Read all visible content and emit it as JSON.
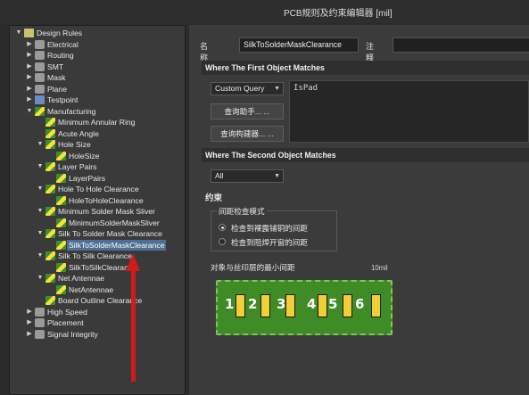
{
  "window": {
    "title": "PCB规则及约束编辑器 [mil]"
  },
  "tree": {
    "items": [
      {
        "label": "Design Rules",
        "level": 0,
        "expander": "▼",
        "icon": "folder"
      },
      {
        "label": "Electrical",
        "level": 1,
        "expander": "▶",
        "icon": "gray"
      },
      {
        "label": "Routing",
        "level": 1,
        "expander": "▶",
        "icon": "gray"
      },
      {
        "label": "SMT",
        "level": 1,
        "expander": "▶",
        "icon": "gray"
      },
      {
        "label": "Mask",
        "level": 1,
        "expander": "▶",
        "icon": "gray"
      },
      {
        "label": "Plane",
        "level": 1,
        "expander": "▶",
        "icon": "gray"
      },
      {
        "label": "Testpoint",
        "level": 1,
        "expander": "▶",
        "icon": "blue"
      },
      {
        "label": "Manufacturing",
        "level": 1,
        "expander": "▼",
        "icon": "rule"
      },
      {
        "label": "Minimum Annular Ring",
        "level": 2,
        "expander": "",
        "icon": "rule"
      },
      {
        "label": "Acute Angle",
        "level": 2,
        "expander": "",
        "icon": "rule"
      },
      {
        "label": "Hole Size",
        "level": 2,
        "expander": "▼",
        "icon": "rule"
      },
      {
        "label": "HoleSize",
        "level": 3,
        "expander": "",
        "icon": "rule"
      },
      {
        "label": "Layer Pairs",
        "level": 2,
        "expander": "▼",
        "icon": "rule"
      },
      {
        "label": "LayerPairs",
        "level": 3,
        "expander": "",
        "icon": "rule"
      },
      {
        "label": "Hole To Hole Clearance",
        "level": 2,
        "expander": "▼",
        "icon": "rule"
      },
      {
        "label": "HoleToHoleClearance",
        "level": 3,
        "expander": "",
        "icon": "rule"
      },
      {
        "label": "Minimum Solder Mask Sliver",
        "level": 2,
        "expander": "▼",
        "icon": "rule"
      },
      {
        "label": "MinimumSolderMaskSliver",
        "level": 3,
        "expander": "",
        "icon": "rule"
      },
      {
        "label": "Silk To Solder Mask Clearance",
        "level": 2,
        "expander": "▼",
        "icon": "rule"
      },
      {
        "label": "SilkToSolderMaskClearance",
        "level": 3,
        "expander": "",
        "icon": "rule",
        "selected": true
      },
      {
        "label": "Silk To Silk Clearance",
        "level": 2,
        "expander": "▼",
        "icon": "rule"
      },
      {
        "label": "SilkToSilkClearance",
        "level": 3,
        "expander": "",
        "icon": "rule"
      },
      {
        "label": "Net Antennae",
        "level": 2,
        "expander": "▼",
        "icon": "rule"
      },
      {
        "label": "NetAntennae",
        "level": 3,
        "expander": "",
        "icon": "rule"
      },
      {
        "label": "Board Outline Clearance",
        "level": 2,
        "expander": "",
        "icon": "rule"
      },
      {
        "label": "High Speed",
        "level": 1,
        "expander": "▶",
        "icon": "gray"
      },
      {
        "label": "Placement",
        "level": 1,
        "expander": "▶",
        "icon": "gray"
      },
      {
        "label": "Signal Integrity",
        "level": 1,
        "expander": "▶",
        "icon": "gray"
      }
    ]
  },
  "rule": {
    "name_label": "名称",
    "name_value": "SilkToSolderMaskClearance",
    "comment_label": "注释",
    "comment_value": ""
  },
  "first_match": {
    "header": "Where The First Object Matches",
    "query_type": "Custom Query",
    "query_helper": "查询助手... ...",
    "query_builder": "查询构建器... ...",
    "query_text": "IsPad"
  },
  "second_match": {
    "header": "Where The Second Object Matches",
    "query_type": "All"
  },
  "constraints": {
    "title": "约束",
    "group_title": "间距检查模式",
    "options": [
      {
        "label": "检查到裸露铺铜的间距",
        "selected": true
      },
      {
        "label": "检查到阻焊开窗的间距",
        "selected": false
      }
    ],
    "min_clearance_label": "对象与丝印层的最小间距",
    "min_clearance_value": "10mil",
    "pad_numbers": [
      "1",
      "2",
      "3",
      "4",
      "5",
      "6"
    ]
  },
  "colors": {
    "selection": "#4d6f93",
    "board": "#3f8b26",
    "pad": "#f2cf36",
    "annotation_arrow": "#d11b1b"
  }
}
